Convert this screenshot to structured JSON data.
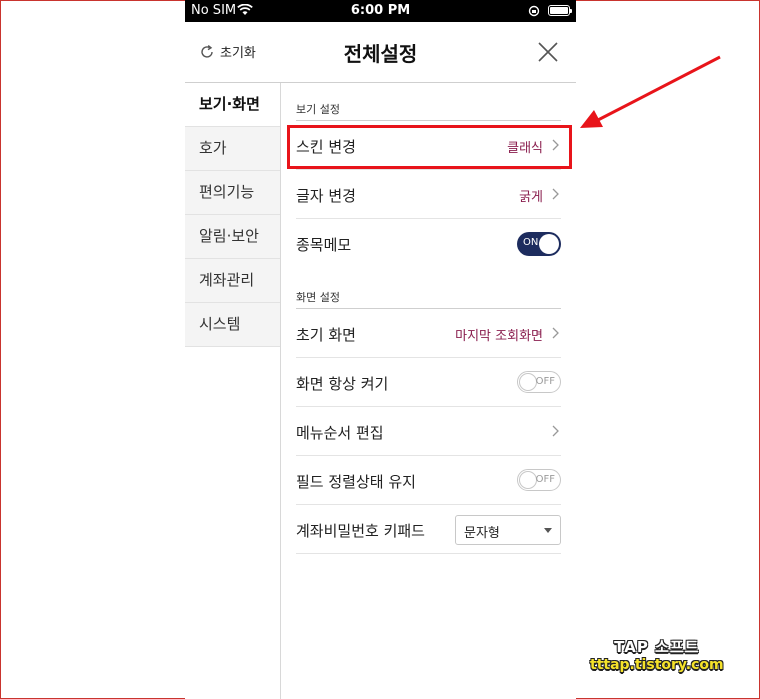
{
  "status_bar": {
    "carrier": "No SIM",
    "time": "6:00 PM"
  },
  "header": {
    "reset_label": "초기화",
    "title": "전체설정"
  },
  "sidebar": {
    "items": [
      {
        "label": "보기·화면",
        "active": true
      },
      {
        "label": "호가"
      },
      {
        "label": "편의기능"
      },
      {
        "label": "알림·보안"
      },
      {
        "label": "계좌관리"
      },
      {
        "label": "시스템"
      }
    ]
  },
  "view_settings": {
    "section_label": "보기 설정",
    "rows": [
      {
        "label": "스킨 변경",
        "value": "클래식"
      },
      {
        "label": "글자 변경",
        "value": "굵게"
      },
      {
        "label": "종목메모",
        "toggle": "ON"
      }
    ]
  },
  "screen_settings": {
    "section_label": "화면 설정",
    "rows": [
      {
        "label": "초기 화면",
        "value": "마지막 조회화면"
      },
      {
        "label": "화면 항상 켜기",
        "toggle": "OFF"
      },
      {
        "label": "메뉴순서 편집"
      },
      {
        "label": "필드 정렬상태 유지",
        "toggle": "OFF"
      },
      {
        "label": "계좌비밀번호 키패드",
        "select_value": "문자형"
      }
    ]
  },
  "watermark": {
    "line1": "TAP 소프트",
    "line2": "tttap.tistory.com"
  },
  "colors": {
    "accent_value": "#8a1e4e",
    "toggle_on": "#1d2c5e",
    "highlight": "#e8141a"
  }
}
